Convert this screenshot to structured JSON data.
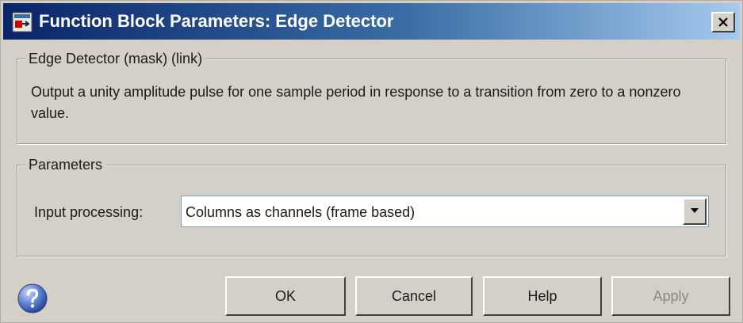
{
  "window": {
    "title": "Function Block Parameters: Edge Detector"
  },
  "description_group": {
    "legend": "Edge Detector (mask) (link)",
    "text": "Output a unity amplitude pulse for one sample period in response to a transition from zero to a nonzero value."
  },
  "parameters_group": {
    "legend": "Parameters",
    "input_processing": {
      "label": "Input processing:",
      "selected": "Columns as channels (frame based)"
    }
  },
  "buttons": {
    "ok": "OK",
    "cancel": "Cancel",
    "help": "Help",
    "apply": "Apply"
  },
  "icons": {
    "app": "simulink-block-icon",
    "close": "close-icon",
    "dropdown": "chevron-down-icon",
    "help": "help-circle-icon"
  },
  "colors": {
    "titlebar_start": "#0a246a",
    "titlebar_end": "#a6caf0",
    "dialog_bg": "#d4d0c8"
  }
}
